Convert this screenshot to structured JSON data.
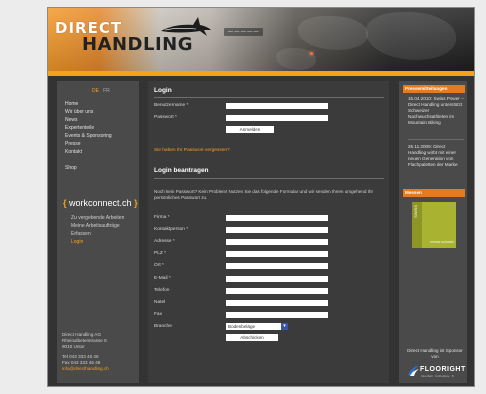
{
  "header": {
    "logo_line1": "DIRECT",
    "logo_line2": "HANDLING",
    "tagline": "— — — — —"
  },
  "left": {
    "lang_de": "DE",
    "lang_fr": "FR",
    "nav": [
      "Home",
      "Wir über uns",
      "News",
      "Expertenteile",
      "Events & Sponsoring",
      "Presse",
      "Kontakt"
    ],
    "nav_shop": "Shop",
    "wc_open": "{",
    "wc_label": "workconnect.ch",
    "wc_close": "}",
    "wc_nav": [
      "Zu vergebende Arbeiten",
      "Meine Arbeitsaufträge",
      "Erfassen",
      "Login"
    ],
    "address": [
      "Direct Handling AG",
      "Rheinalbeterstrasse 8",
      "9010 Untor",
      "",
      "Tel 043 333 46 46",
      "Fax 043 333 46 46"
    ],
    "email": "info@directhandling.ch"
  },
  "login": {
    "title": "Login",
    "user_label": "Benutzername *",
    "pass_label": "Passwort *",
    "submit": "Anmelden",
    "forgot": "Sie haben Ihr Passwort vergessen?"
  },
  "register": {
    "title": "Login beantragen",
    "intro": "Noch kein Passwort? Kein Problem! Nutzen Sie das folgende Formular und wir senden Ihnen umgehend Ihr persönliches Passwort zu.",
    "fields": [
      "Firma *",
      "Kontaktperson *",
      "Adresse *",
      "PLZ *",
      "Ort *",
      "E-Mail *",
      "Telefon",
      "Natel",
      "Fax"
    ],
    "branch_label": "Branche",
    "branch_value": "Bodenbeläge",
    "submit": "Abschicken"
  },
  "right": {
    "news_title": "Pressemitteilungen",
    "news": [
      "15.04.2010: Swiss Power – Direct Handling unterstützt Schweizer Nachwuchsathleten im Mountain Biking",
      "25.11.2009: Direct Handling wirbt mit einer neuen Generation von Flachpaletten der Marke"
    ],
    "messe_title": "Messen",
    "messe_tag": "SWISS",
    "messe_caption": "messe schweiz",
    "floor_text": "Direct Handling ist Sponsor von",
    "floor_word": "FLOORIGHT",
    "floor_sub": "Floorball · Unihockey · 8"
  },
  "colors": {
    "accent": "#f4a21c",
    "panel": "#4a4a4a",
    "center": "#3b3b3b",
    "outer": "#333333"
  }
}
